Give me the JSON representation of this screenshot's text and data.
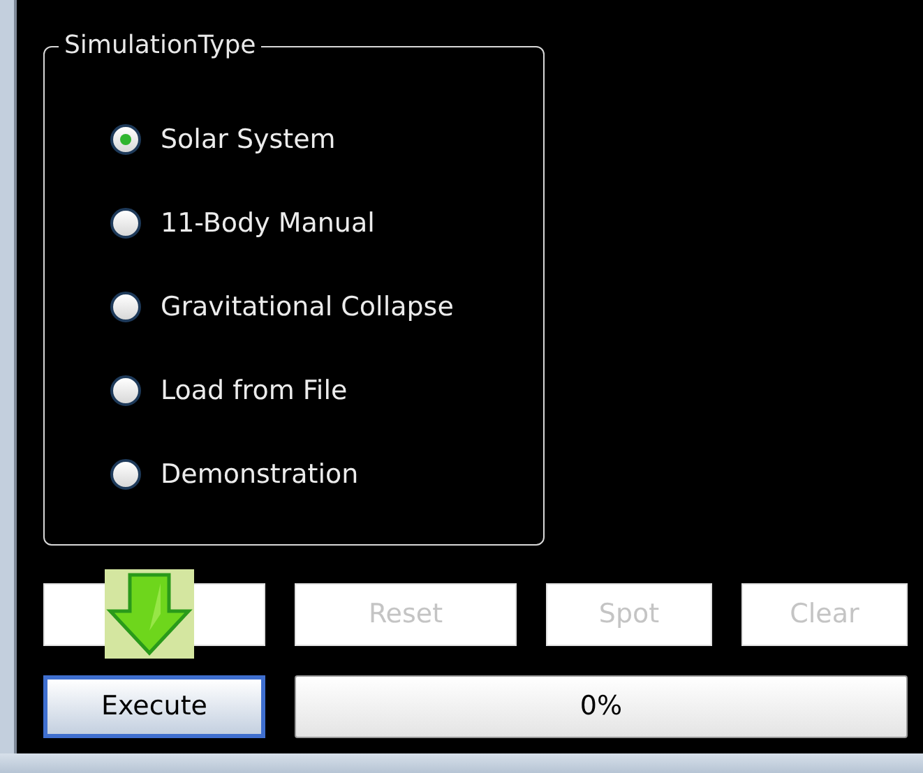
{
  "group": {
    "title": "SimulationType"
  },
  "options": [
    {
      "label": "Solar System",
      "selected": true
    },
    {
      "label": "11-Body Manual",
      "selected": false
    },
    {
      "label": "Gravitational Collapse",
      "selected": false
    },
    {
      "label": "Load from File",
      "selected": false
    },
    {
      "label": "Demonstration",
      "selected": false
    }
  ],
  "buttons": [
    {
      "disabled": true
    },
    {
      "label": "Reset",
      "disabled": true
    },
    {
      "label": "Spot",
      "disabled": true
    },
    {
      "label": "Clear",
      "disabled": true
    }
  ],
  "execute": {
    "label": "Execute",
    "disabled": false
  },
  "progress": {
    "level": 0,
    "text": "0%"
  }
}
